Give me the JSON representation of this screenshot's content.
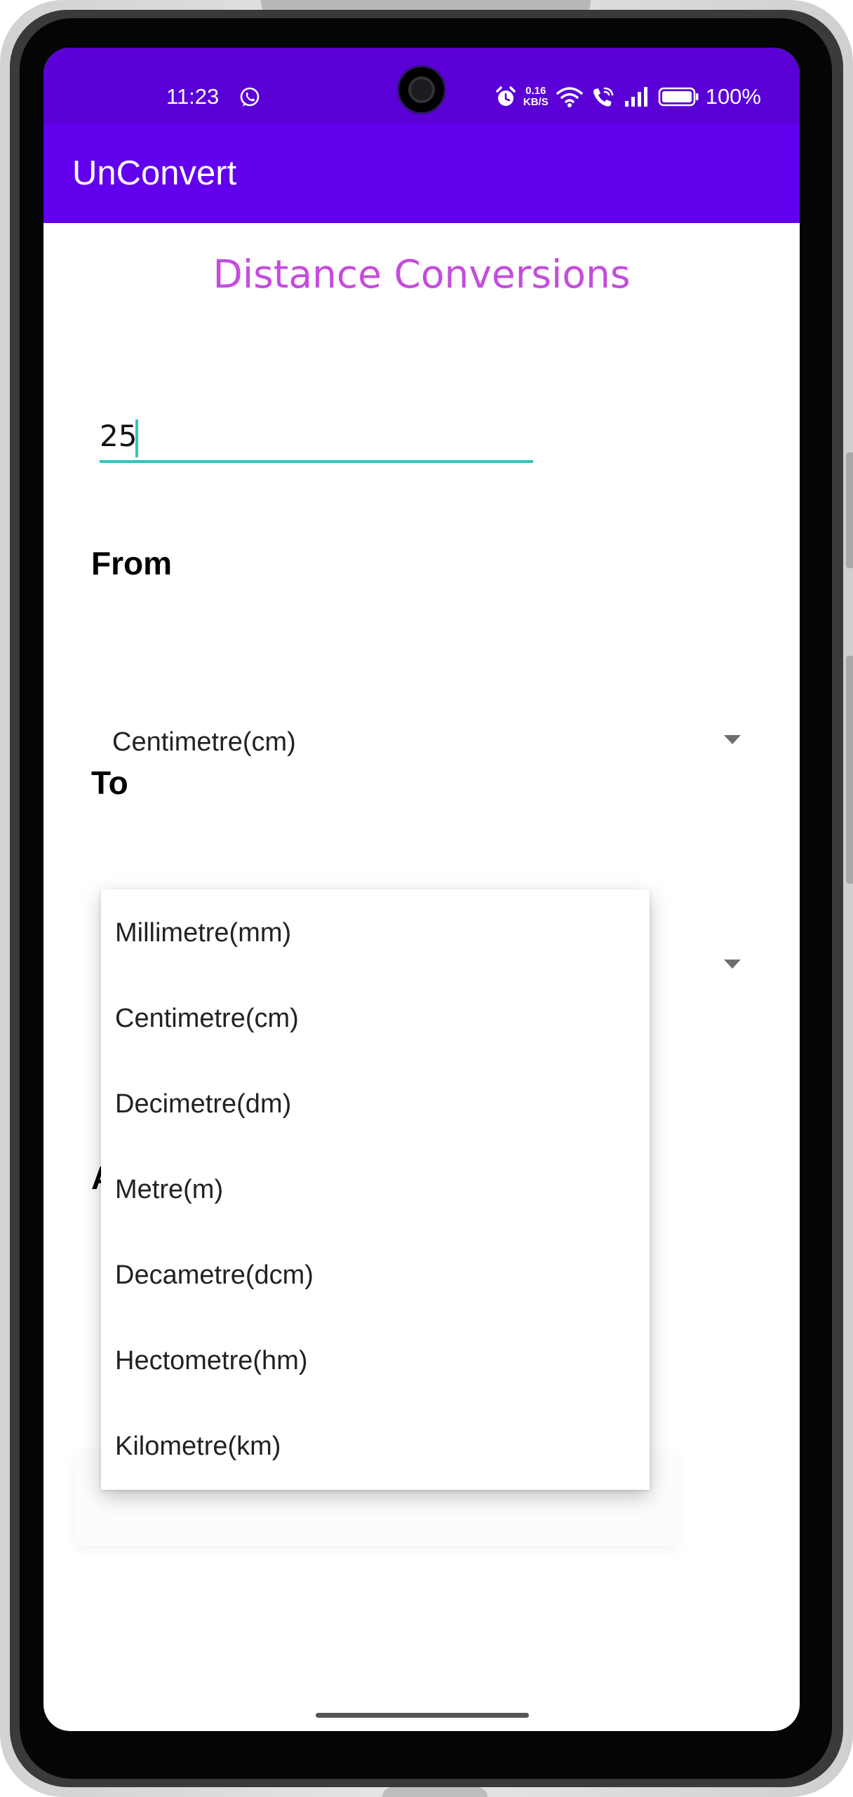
{
  "status_bar": {
    "time": "11:23",
    "net_speed_value": "0.16",
    "net_speed_unit": "KB/S",
    "battery": "100%",
    "icons": [
      "whatsapp-icon",
      "alarm-icon",
      "wifi-icon",
      "wifi-calling-icon",
      "signal-icon",
      "battery-icon"
    ]
  },
  "app_bar": {
    "title": "UnConvert",
    "color": "#6200ee"
  },
  "page": {
    "title": "Distance Conversions",
    "title_color": "#c44ddc"
  },
  "amount_input": {
    "value": "25",
    "underline_color": "#2ec7b8"
  },
  "from": {
    "label": "From",
    "selected": "Centimetre(cm)"
  },
  "to": {
    "label": "To",
    "hidden_label_fragment": "A"
  },
  "dropdown": {
    "items": [
      "Millimetre(mm)",
      "Centimetre(cm)",
      "Decimetre(dm)",
      "Metre(m)",
      "Decametre(dcm)",
      "Hectometre(hm)",
      "Kilometre(km)"
    ]
  }
}
